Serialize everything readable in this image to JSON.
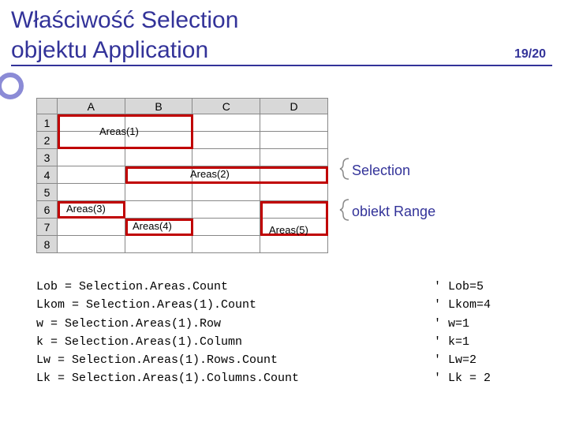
{
  "header": {
    "title": "Właściwość Selection\nobjektu Application",
    "page_indicator": "19/20"
  },
  "sheet": {
    "columns": [
      "A",
      "B",
      "C",
      "D"
    ],
    "rows": [
      "1",
      "2",
      "3",
      "4",
      "5",
      "6",
      "7",
      "8"
    ]
  },
  "areas": {
    "a1": "Areas(1)",
    "a2": "Areas(2)",
    "a3": "Areas(3)",
    "a4": "Areas(4)",
    "a5": "Areas(5)"
  },
  "annotations": {
    "selection": "Selection",
    "range": "obiekt Range"
  },
  "code": {
    "lines": [
      "Lob = Selection.Areas.Count",
      "Lkom = Selection.Areas(1).Count",
      "w = Selection.Areas(1).Row",
      "k = Selection.Areas(1).Column",
      "Lw = Selection.Areas(1).Rows.Count",
      "Lk = Selection.Areas(1).Columns.Count"
    ],
    "comments": [
      "' Lob=5",
      "' Lkom=4",
      "' w=1",
      "' k=1",
      "' Lw=2",
      "' Lk = 2"
    ]
  }
}
